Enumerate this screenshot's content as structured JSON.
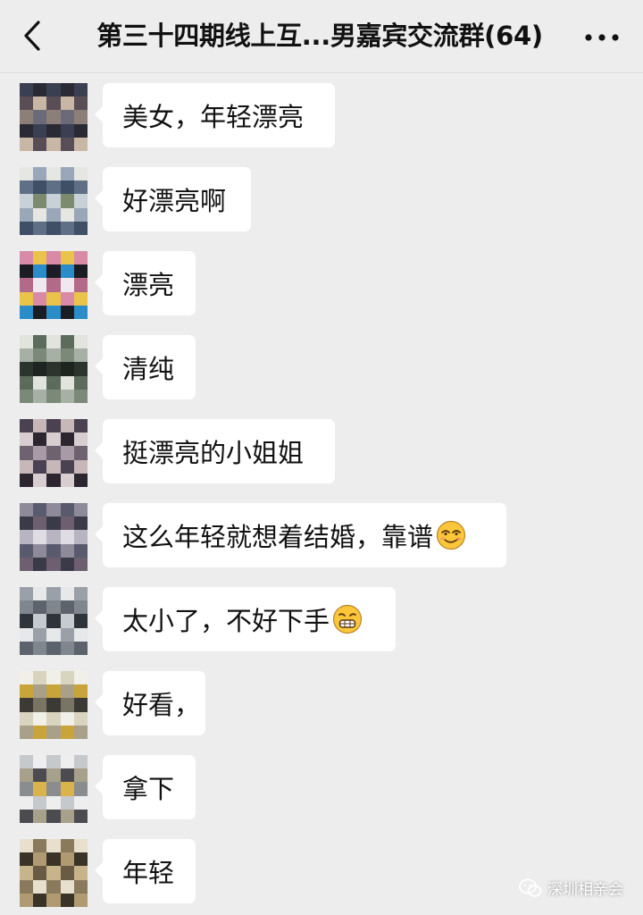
{
  "header": {
    "title": "第三十四期线上互...男嘉宾交流群(64)",
    "back_icon": "chevron-left-icon",
    "more_icon": "more-dots-icon"
  },
  "messages": [
    {
      "text": "美女，年轻漂亮",
      "emoji": null
    },
    {
      "text": "好漂亮啊",
      "emoji": null
    },
    {
      "text": "漂亮",
      "emoji": null
    },
    {
      "text": "清纯",
      "emoji": null
    },
    {
      "text": "挺漂亮的小姐姐",
      "emoji": null
    },
    {
      "text": "这么年轻就想着结婚，靠谱",
      "emoji": "smirk-emoji"
    },
    {
      "text": "太小了，不好下手",
      "emoji": "grin-emoji"
    },
    {
      "text": "好看，",
      "emoji": null
    },
    {
      "text": "拿下",
      "emoji": null
    },
    {
      "text": "年轻",
      "emoji": null
    }
  ],
  "watermark": {
    "text": "深圳相亲会",
    "icon": "wechat-icon"
  },
  "colors": {
    "background": "#ededed",
    "bubble": "#ffffff",
    "text": "#111111"
  }
}
